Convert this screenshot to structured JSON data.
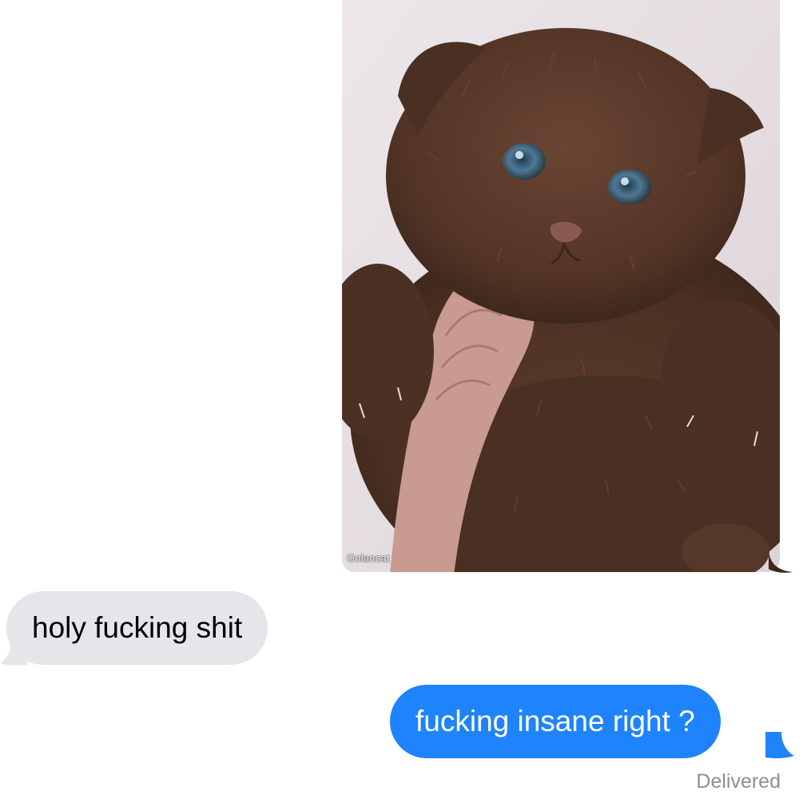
{
  "conversation": {
    "image_message": {
      "watermark": "Golancat",
      "subject": "chocolate-brown fluffy kitten held in a hand"
    },
    "received_message": "holy fucking shit",
    "sent_message": "fucking insane right ?",
    "status": "Delivered"
  },
  "colors": {
    "sent_bubble": "#1f84fb",
    "received_bubble": "#e5e5ea",
    "status_text": "#8e8e93"
  }
}
